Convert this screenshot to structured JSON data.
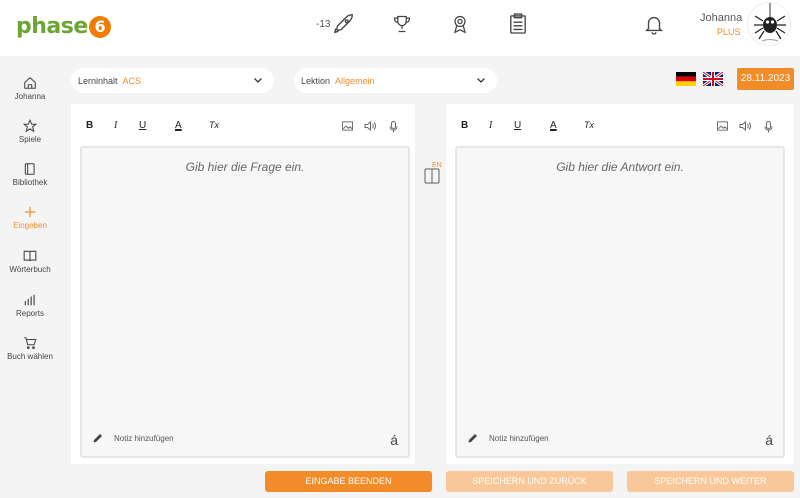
{
  "header": {
    "logo_text": "phase",
    "logo_digit": "6",
    "streak_count": "-13",
    "icons": [
      "rocket-icon",
      "trophy-icon",
      "award-icon",
      "clipboard-icon",
      "bell-icon"
    ],
    "user_name": "Johanna",
    "user_plan": "PLUS"
  },
  "sidebar": {
    "items": [
      {
        "label": "Johanna",
        "icon": "home-icon"
      },
      {
        "label": "Spiele",
        "icon": "star-icon"
      },
      {
        "label": "Bibliothek",
        "icon": "book-icon"
      },
      {
        "label": "Eingeben",
        "icon": "plus-icon",
        "active": true
      },
      {
        "label": "Wörterbuch",
        "icon": "open-book-icon"
      },
      {
        "label": "Reports",
        "icon": "bar-chart-icon"
      },
      {
        "label": "Buch wählen",
        "icon": "cart-icon"
      }
    ]
  },
  "selectors": {
    "content_label": "Lerninhalt",
    "content_value": "ACS",
    "lesson_label": "Lektion",
    "lesson_value": "Allgemein"
  },
  "date": "28.11.2023",
  "toolbar": {
    "bold": "B",
    "italic": "I",
    "underline": "U",
    "color": "A",
    "clear": "Tx"
  },
  "question": {
    "placeholder": "Gib hier die Frage ein.",
    "note": "Notiz hinzufügen",
    "accent": "á"
  },
  "answer": {
    "placeholder": "Gib hier die Antwort ein.",
    "note": "Notiz hinzufügen",
    "accent": "á"
  },
  "swap_lang": "EN",
  "buttons": {
    "end": "EINGABE BEENDEN",
    "save_back": "SPEICHERN UND ZURÜCK",
    "save_next": "SPEICHERN UND WEITER"
  },
  "colors": {
    "accent": "#f28c28",
    "logo_green": "#6ca534",
    "button_disabled": "#f8c89a"
  }
}
